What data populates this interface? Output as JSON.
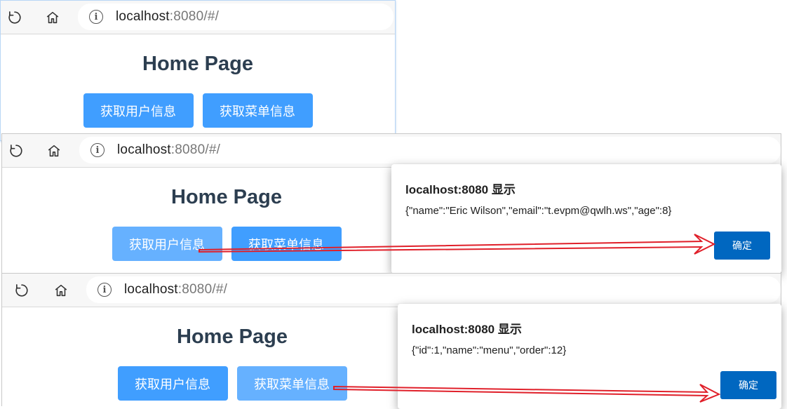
{
  "browser": {
    "url_host": "localhost",
    "url_rest": ":8080/#/"
  },
  "page": {
    "title": "Home Page",
    "user_button": "获取用户信息",
    "menu_button": "获取菜单信息"
  },
  "dialogs": [
    {
      "title": "localhost:8080 显示",
      "message": "{\"name\":\"Eric Wilson\",\"email\":\"t.evpm@qwlh.ws\",\"age\":8}",
      "ok": "确定"
    },
    {
      "title": "localhost:8080 显示",
      "message": "{\"id\":1,\"name\":\"menu\",\"order\":12}",
      "ok": "确定"
    }
  ],
  "colors": {
    "primary": "#409eff",
    "primary_hover": "#66b1ff",
    "title": "#2c3e50",
    "dialog_button": "#0067c0",
    "arrow": "#e0202a"
  }
}
